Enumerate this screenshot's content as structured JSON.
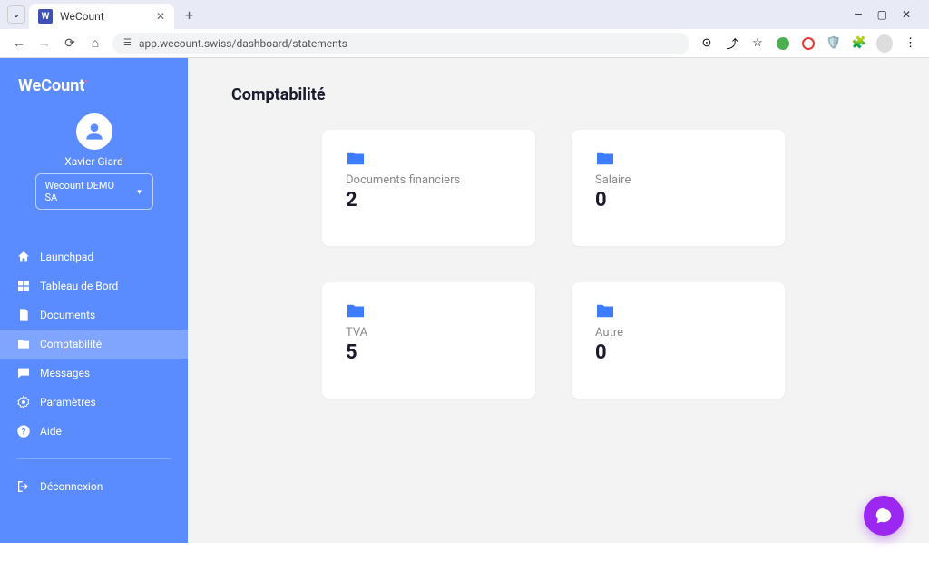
{
  "browser": {
    "tab_title": "WeCount",
    "url": "app.wecount.swiss/dashboard/statements"
  },
  "app": {
    "logo": "WeCount",
    "profile": {
      "name": "Xavier Giard",
      "company": "Wecount DEMO SA"
    },
    "nav": {
      "launchpad": "Launchpad",
      "dashboard": "Tableau de Bord",
      "documents": "Documents",
      "accounting": "Comptabilité",
      "messages": "Messages",
      "settings": "Paramètres",
      "help": "Aide",
      "logout": "Déconnexion"
    },
    "page_title": "Comptabilité",
    "cards": [
      {
        "label": "Documents financiers",
        "count": "2"
      },
      {
        "label": "Salaire",
        "count": "0"
      },
      {
        "label": "TVA",
        "count": "5"
      },
      {
        "label": "Autre",
        "count": "0"
      }
    ]
  }
}
